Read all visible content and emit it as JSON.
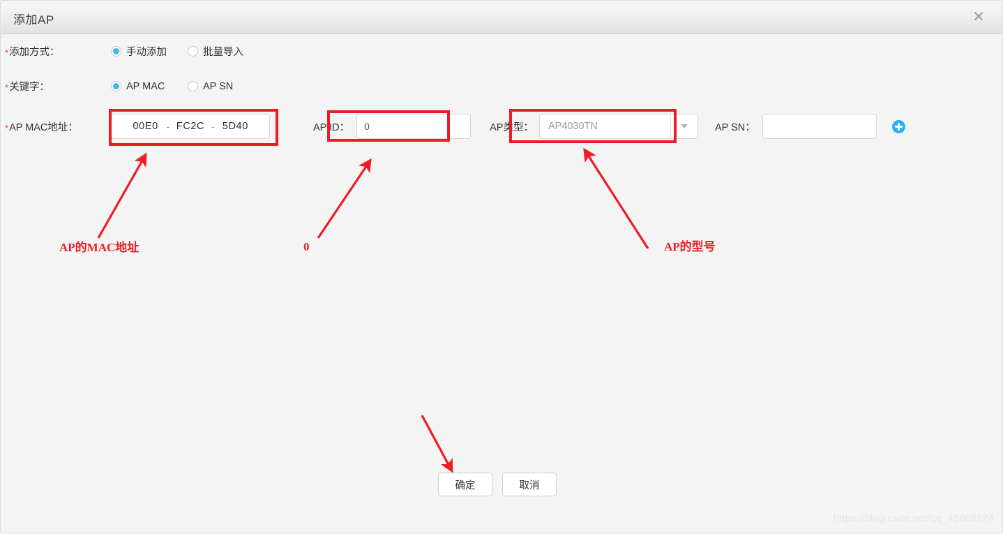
{
  "dialog": {
    "title": "添加AP",
    "close_icon": "close-icon"
  },
  "form": {
    "add_mode": {
      "label": "添加方式：",
      "required": true,
      "options": [
        {
          "label": "手动添加",
          "checked": true
        },
        {
          "label": "批量导入",
          "checked": false
        }
      ]
    },
    "keyword": {
      "label": "关键字：",
      "required": true,
      "options": [
        {
          "label": "AP MAC",
          "checked": true
        },
        {
          "label": "AP SN",
          "checked": false
        }
      ]
    },
    "ap_mac": {
      "label": "AP MAC地址：",
      "required": true,
      "separator": "-",
      "segments": [
        "00E0",
        "FC2C",
        "5D40"
      ]
    },
    "ap_id": {
      "label": "AP ID：",
      "value": "0",
      "placeholder": ""
    },
    "ap_type": {
      "label": "AP类型：",
      "value": "AP4030TN",
      "arrow_icon": "chevron-down-icon"
    },
    "ap_sn": {
      "label": "AP SN：",
      "value": "",
      "placeholder": ""
    },
    "add_button_icon": "plus-circle-icon"
  },
  "footer": {
    "confirm_label": "确定",
    "cancel_label": "取消"
  },
  "annotations": {
    "mac_note": "AP的MAC地址",
    "id_note": "0",
    "type_note": "AP的型号",
    "highlight_color": "#ec1c24"
  },
  "watermark": "https://blog.csdn.net/qq_45668124"
}
